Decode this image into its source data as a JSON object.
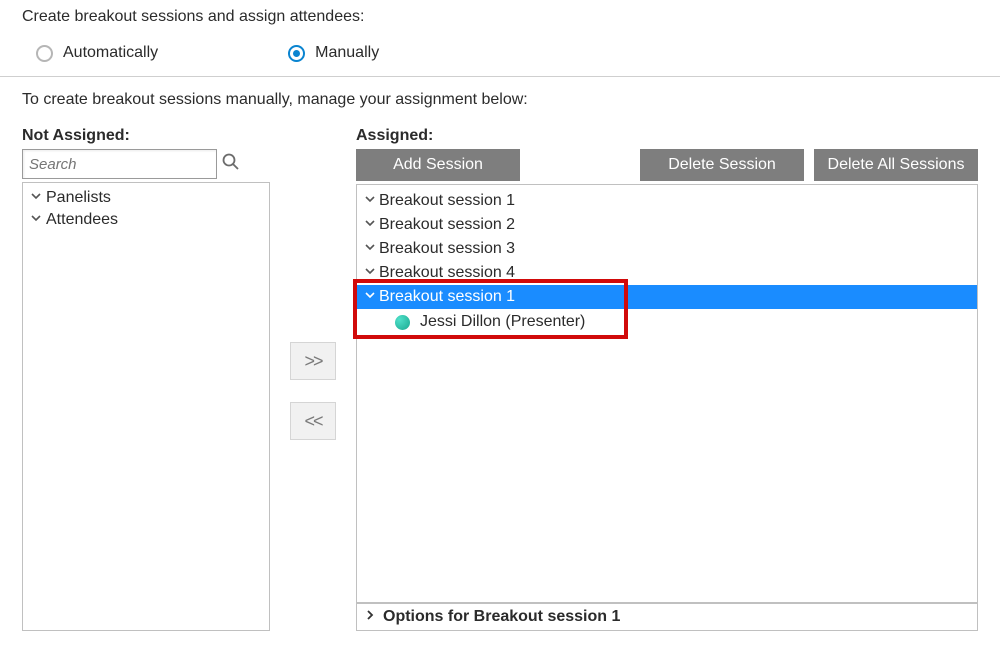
{
  "heading": "Create breakout sessions and assign attendees:",
  "radios": {
    "auto": {
      "label": "Automatically",
      "checked": false
    },
    "manual": {
      "label": "Manually",
      "checked": true
    }
  },
  "instruction": "To create breakout sessions manually, manage your assignment below:",
  "left": {
    "title": "Not Assigned:",
    "searchPlaceholder": "Search",
    "groups": {
      "panelists": "Panelists",
      "attendees": "Attendees"
    }
  },
  "moveButtons": {
    "right": ">>",
    "left": "<<"
  },
  "right": {
    "title": "Assigned:",
    "buttons": {
      "add": "Add Session",
      "delete": "Delete Session",
      "deleteAll": "Delete All Sessions"
    },
    "sessions": [
      {
        "label": "Breakout session 1"
      },
      {
        "label": "Breakout session 2"
      },
      {
        "label": "Breakout session 3"
      },
      {
        "label": "Breakout session 4"
      }
    ],
    "selectedSession": {
      "label": "Breakout session 1"
    },
    "attendee": {
      "name": "Jessi Dillon (Presenter)"
    },
    "options": "Options for Breakout session 1"
  }
}
